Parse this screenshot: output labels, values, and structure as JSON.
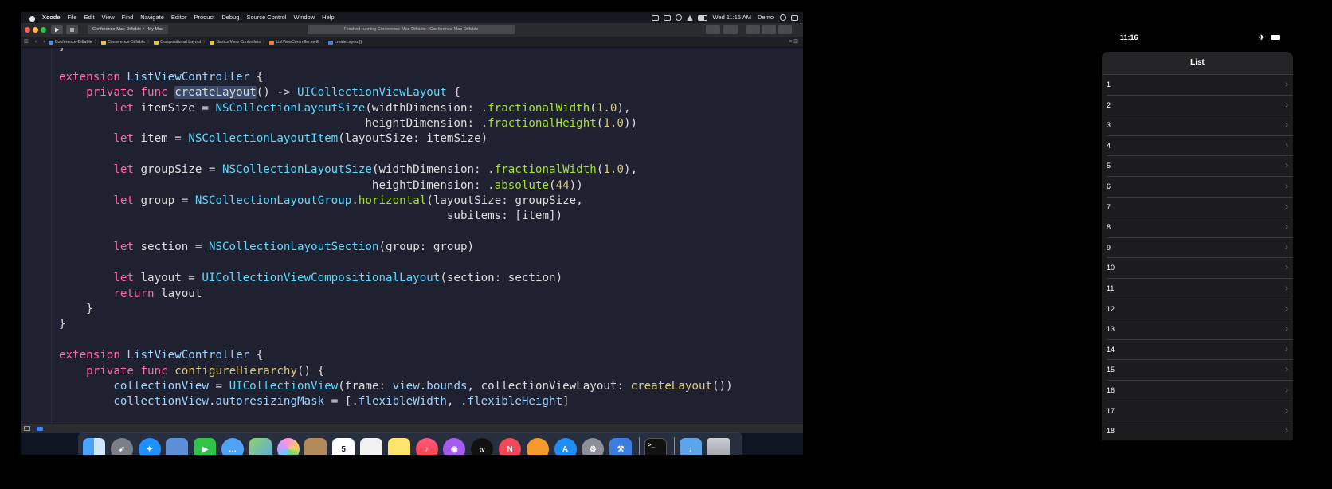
{
  "menubar": {
    "app": "Xcode",
    "items": [
      "File",
      "Edit",
      "View",
      "Find",
      "Navigate",
      "Editor",
      "Product",
      "Debug",
      "Source Control",
      "Window",
      "Help"
    ],
    "clock": "Wed 11:15 AM",
    "user": "Demo"
  },
  "toolbar": {
    "scheme": "Conference-Mac-Diffable",
    "destination": "My Mac",
    "activity": "Finished running Conference-Mac-Diffable : Conference-Mac-Diffable"
  },
  "jumpbar": {
    "crumbs": [
      "Conference-Diffable",
      "Conference-Diffable",
      "Compositional Layout",
      "Basics View Controllers",
      "ListViewController.swift",
      "createLayout()"
    ]
  },
  "code": {
    "lines": [
      "}",
      "",
      "extension ListViewController {",
      "    private func createLayout() -> UICollectionViewLayout {",
      "        let itemSize = NSCollectionLayoutSize(widthDimension: .fractionalWidth(1.0),",
      "                                             heightDimension: .fractionalHeight(1.0))",
      "        let item = NSCollectionLayoutItem(layoutSize: itemSize)",
      "",
      "        let groupSize = NSCollectionLayoutSize(widthDimension: .fractionalWidth(1.0),",
      "                                              heightDimension: .absolute(44))",
      "        let group = NSCollectionLayoutGroup.horizontal(layoutSize: groupSize,",
      "                                                         subitems: [item])",
      "",
      "        let section = NSCollectionLayoutSection(group: group)",
      "",
      "        let layout = UICollectionViewCompositionalLayout(section: section)",
      "        return layout",
      "    }",
      "}",
      "",
      "extension ListViewController {",
      "    private func configureHierarchy() {",
      "        collectionView = UICollectionView(frame: view.bounds, collectionViewLayout: createLayout())",
      "        collectionView.autoresizingMask = [.flexibleWidth, .flexibleHeight]"
    ]
  },
  "phone": {
    "time": "11:16",
    "airplane_icon": "airplane-icon",
    "title": "List",
    "rows": [
      "1",
      "2",
      "3",
      "4",
      "5",
      "6",
      "7",
      "8",
      "9",
      "10",
      "11",
      "12",
      "13",
      "14",
      "15",
      "16",
      "17",
      "18"
    ],
    "chevron": "›"
  },
  "dock": {
    "calendar_day": "5",
    "apps": [
      "finder",
      "launchpad",
      "safari",
      "preview",
      "facetime",
      "messages",
      "maps",
      "photos",
      "contacts",
      "calendar",
      "reminders",
      "notes",
      "music",
      "podcasts",
      "tv",
      "news",
      "books",
      "app-store",
      "system-preferences",
      "xcode",
      "terminal",
      "downloads",
      "trash"
    ]
  },
  "colors": {
    "keyword": "#fc6aa7",
    "type": "#5dd8ff",
    "function": "#d9c97c",
    "editor_bg": "#1f2030"
  }
}
